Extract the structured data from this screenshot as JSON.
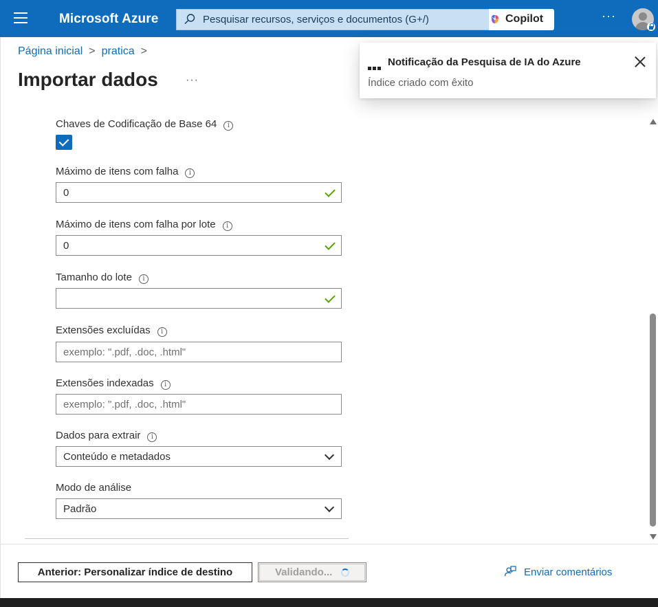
{
  "header": {
    "brand": "Microsoft Azure",
    "search_placeholder": "Pesquisar recursos, serviços e documentos (G+/)",
    "copilot_label": "Copilot",
    "more_label": "···"
  },
  "breadcrumb": {
    "home": "Página inicial",
    "resource": "pratica",
    "separator": ">"
  },
  "page": {
    "title": "Importar dados",
    "more_label": "···"
  },
  "form": {
    "base64": {
      "label": "Chaves de Codificação de Base 64",
      "checked": true
    },
    "max_failed": {
      "label": "Máximo de itens com falha",
      "value": "0",
      "valid": true
    },
    "max_failed_batch": {
      "label": "Máximo de itens com falha por lote",
      "value": "0",
      "valid": true
    },
    "batch_size": {
      "label": "Tamanho do lote",
      "value": "",
      "valid": true
    },
    "excluded_ext": {
      "label": "Extensões excluídas",
      "placeholder": "exemplo: \".pdf, .doc, .html\""
    },
    "indexed_ext": {
      "label": "Extensões indexadas",
      "placeholder": "exemplo: \".pdf, .doc, .html\""
    },
    "data_to_extract": {
      "label": "Dados para extrair",
      "value": "Conteúdo e metadados"
    },
    "parsing_mode": {
      "label": "Modo de análise",
      "value": "Padrão"
    },
    "info_glyph": "i"
  },
  "footer": {
    "prev_label": "Anterior: Personalizar índice de destino",
    "validate_label": "Validando...",
    "feedback_label": "Enviar comentários"
  },
  "notification": {
    "title": "Notificação da Pesquisa de IA do Azure",
    "message": "Índice criado com êxito"
  },
  "colors": {
    "accent": "#0f6cbd",
    "valid": "#57a300"
  }
}
